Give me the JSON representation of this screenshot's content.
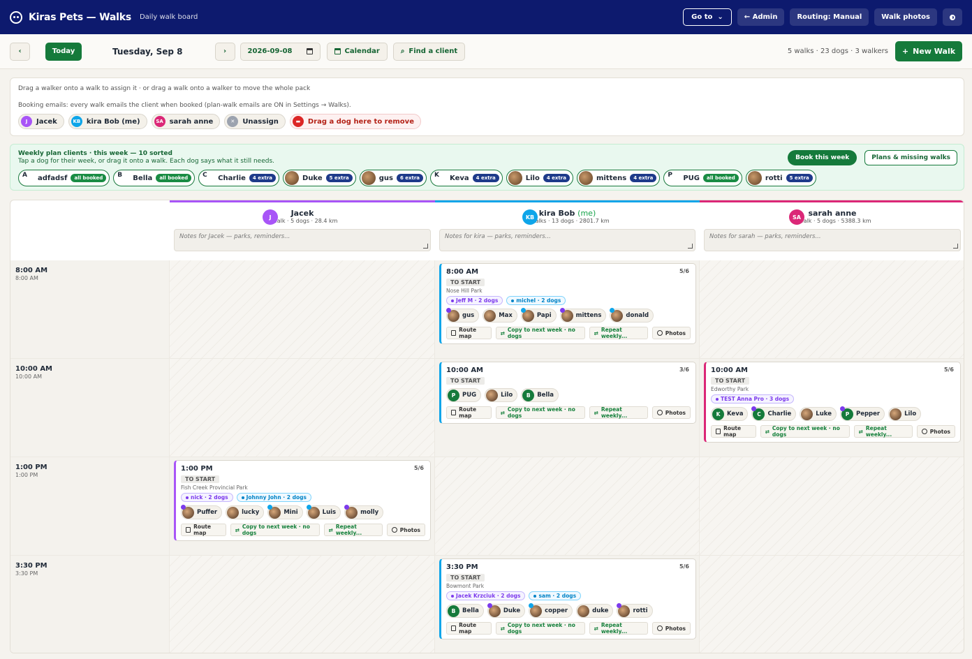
{
  "header": {
    "app_title": "Kiras Pets — Walks",
    "subtitle": "Daily walk board",
    "goto_label": "Go to",
    "admin_label": "← Admin",
    "routing_label": "Routing: Manual",
    "photos_label": "Walk photos",
    "brand_color": "#0d1a6e"
  },
  "toolbar": {
    "prev_label": "‹",
    "today_label": "Today",
    "date_label": "Tuesday, Sep 8",
    "next_label": "›",
    "date_value": "2026-09-08",
    "calendar_label": "Calendar",
    "find_label": "Find a client",
    "summary": "5 walks · 23 dogs · 3 walkers",
    "new_walk_label": "New Walk",
    "accent_color": "#157a3b"
  },
  "assign": {
    "hint": "Drag a walker onto a walk to assign it · or drag a walk onto a walker to move the whole pack",
    "emails_note": "Booking emails: every walk emails the client when booked (plan-walk emails are ON in Settings → Walks).",
    "walkers": [
      {
        "initials": "J",
        "name": "Jacek",
        "color": "#a855f7"
      },
      {
        "initials": "KB",
        "name": "kira Bob (me)",
        "color": "#0ea5e9"
      },
      {
        "initials": "SA",
        "name": "sarah anne",
        "color": "#db2777"
      }
    ],
    "unassign_label": "Unassign",
    "remove_label": "Drag a dog here to remove"
  },
  "weekly": {
    "title": "Weekly plan clients · this week — 10 sorted",
    "subtitle": "Tap a dog for their week, or drag it onto a walk. Each dog says what it still needs.",
    "book_label": "Book this week",
    "plans_label": "Plans & missing walks",
    "dogs": [
      {
        "letter": "A",
        "name": "adfadsf",
        "badge": "all booked",
        "kind": "booked"
      },
      {
        "letter": "B",
        "name": "Bella",
        "badge": "all booked",
        "kind": "booked"
      },
      {
        "letter": "C",
        "name": "Charlie",
        "badge": "4 extra",
        "kind": "extra"
      },
      {
        "letter": "",
        "name": "Duke",
        "badge": "5 extra",
        "kind": "extra"
      },
      {
        "letter": "",
        "name": "gus",
        "badge": "6 extra",
        "kind": "extra"
      },
      {
        "letter": "K",
        "name": "Keva",
        "badge": "4 extra",
        "kind": "extra"
      },
      {
        "letter": "",
        "name": "Lilo",
        "badge": "4 extra",
        "kind": "extra"
      },
      {
        "letter": "",
        "name": "mittens",
        "badge": "4 extra",
        "kind": "extra"
      },
      {
        "letter": "P",
        "name": "PUG",
        "badge": "all booked",
        "kind": "booked"
      },
      {
        "letter": "",
        "name": "rotti",
        "badge": "5 extra",
        "kind": "extra"
      }
    ]
  },
  "board": {
    "columns": [
      {
        "initials": "J",
        "name": "Jacek",
        "me": "",
        "stats": "1 walk · 5 dogs · 28.4 km",
        "notes_placeholder": "Notes for Jacek — parks, reminders...",
        "color": "#a855f7"
      },
      {
        "initials": "KB",
        "name": "kira Bob",
        "me": "(me)",
        "stats": "3 walks · 13 dogs · 2801.7 km",
        "notes_placeholder": "Notes for kira — parks, reminders...",
        "color": "#0ea5e9"
      },
      {
        "initials": "SA",
        "name": "sarah anne",
        "me": "",
        "stats": "1 walk · 5 dogs · 5388.3 km",
        "notes_placeholder": "Notes for sarah — parks, reminders...",
        "color": "#db2777"
      }
    ],
    "times": [
      {
        "label": "8:00 AM",
        "sub": "8:00 AM"
      },
      {
        "label": "10:00 AM",
        "sub": "10:00 AM"
      },
      {
        "label": "1:00 PM",
        "sub": "1:00 PM"
      },
      {
        "label": "3:30 PM",
        "sub": "3:30 PM"
      }
    ],
    "actions": {
      "route": "Route map",
      "copy": "Copy to next week · no dogs",
      "repeat": "Repeat weekly...",
      "photos": "Photos"
    },
    "walks": {
      "kira_8": {
        "time": "8:00 AM",
        "cap": "5/6",
        "status": "TO START",
        "park": "Nose Hill Park",
        "clients": [
          {
            "name": "Jeff M · 2 dogs",
            "c": "purple"
          },
          {
            "name": "michel · 2 dogs",
            "c": "blue"
          }
        ],
        "dogs": [
          {
            "name": "gus",
            "dot": "p"
          },
          {
            "name": "Max",
            "dot": ""
          },
          {
            "name": "Papi",
            "dot": "b"
          },
          {
            "name": "mittens",
            "dot": "p"
          },
          {
            "name": "donald",
            "dot": "b"
          }
        ]
      },
      "kira_10": {
        "time": "10:00 AM",
        "cap": "3/6",
        "status": "TO START",
        "park": "",
        "clients": [],
        "dogs": [
          {
            "name": "PUG",
            "letter": "P"
          },
          {
            "name": "Lilo",
            "dot": ""
          },
          {
            "name": "Bella",
            "letter": "B"
          }
        ]
      },
      "sarah_10": {
        "time": "10:00 AM",
        "cap": "5/6",
        "status": "TO START",
        "park": "Edworthy Park",
        "clients": [
          {
            "name": "TEST Anna Pro · 3 dogs",
            "c": "purple"
          }
        ],
        "dogs": [
          {
            "name": "Keva",
            "letter": "K"
          },
          {
            "name": "Charlie",
            "letter": "C",
            "dot": "p"
          },
          {
            "name": "Luke",
            "dot": ""
          },
          {
            "name": "Pepper",
            "letter": "P",
            "dot": "p"
          },
          {
            "name": "Lilo",
            "dot": ""
          }
        ]
      },
      "jacek_1": {
        "time": "1:00 PM",
        "cap": "5/6",
        "status": "TO START",
        "park": "Fish Creek Provincial Park",
        "clients": [
          {
            "name": "nick · 2 dogs",
            "c": "purple"
          },
          {
            "name": "Johnny John · 2 dogs",
            "c": "blue"
          }
        ],
        "dogs": [
          {
            "name": "Puffer",
            "dot": "p"
          },
          {
            "name": "lucky",
            "dot": ""
          },
          {
            "name": "Mini",
            "dot": "b"
          },
          {
            "name": "Luis",
            "dot": "b"
          },
          {
            "name": "molly",
            "dot": "p"
          }
        ]
      },
      "kira_330": {
        "time": "3:30 PM",
        "cap": "5/6",
        "status": "TO START",
        "park": "Bowmont Park",
        "clients": [
          {
            "name": "Jacek Krzciuk · 2 dogs",
            "c": "purple"
          },
          {
            "name": "sam · 2 dogs",
            "c": "blue"
          }
        ],
        "dogs": [
          {
            "name": "Bella",
            "letter": "B"
          },
          {
            "name": "Duke",
            "dot": "p"
          },
          {
            "name": "copper",
            "dot": "b"
          },
          {
            "name": "duke",
            "dot": ""
          },
          {
            "name": "rotti",
            "dot": "p"
          }
        ]
      }
    }
  }
}
